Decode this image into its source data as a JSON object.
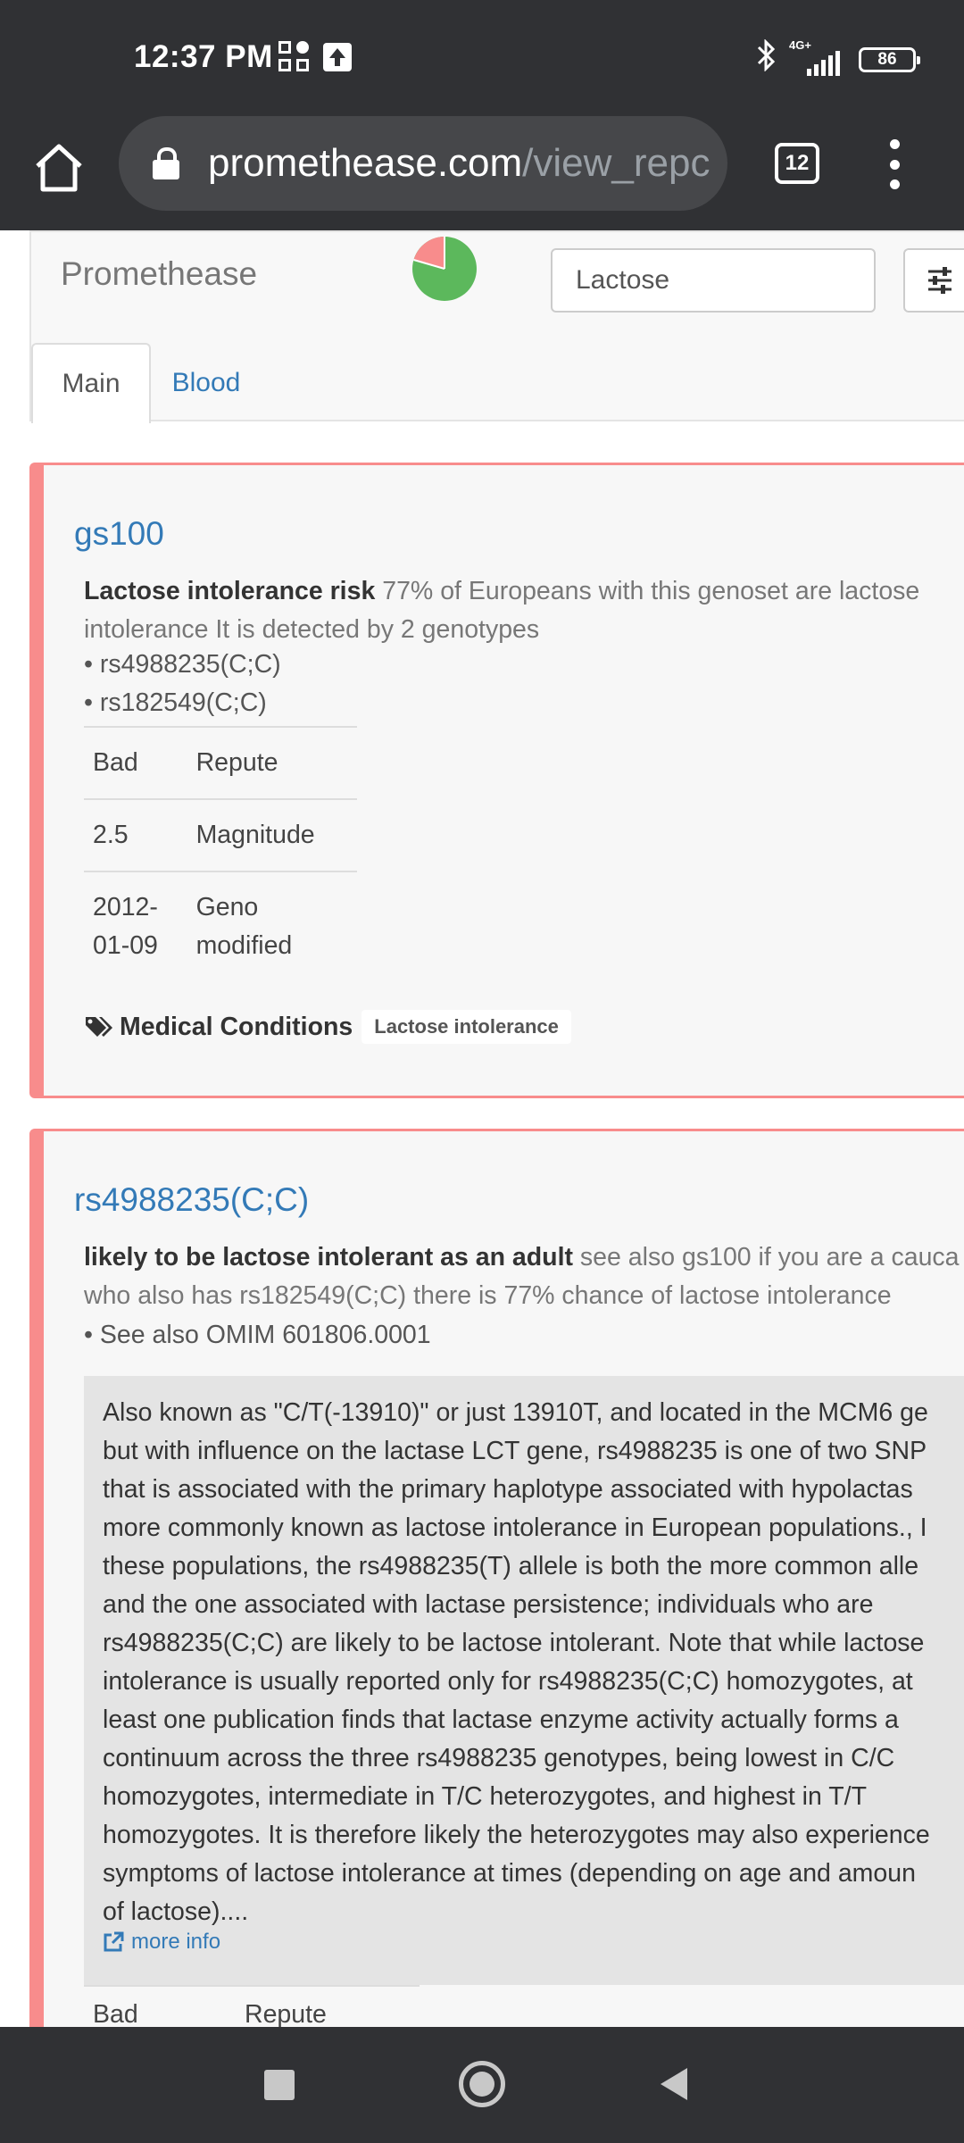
{
  "status_bar": {
    "time": "12:37 PM",
    "network_label": "4G+",
    "battery": "86",
    "icons": [
      "grid-app-icon",
      "upload-notification-icon",
      "bluetooth-icon",
      "signal-icon",
      "battery-icon"
    ]
  },
  "browser": {
    "url_host": "promethease.com",
    "url_path": "/view_repc",
    "tab_count": "12"
  },
  "header": {
    "brand": "Promethease",
    "pie_colors": {
      "good": "#5cb85c",
      "bad": "#f88c8c"
    },
    "search_value": "Lactose",
    "tabs": [
      {
        "label": "Main"
      },
      {
        "label": "Blood"
      }
    ]
  },
  "cards": [
    {
      "title": "gs100",
      "summary_bold": "Lactose intolerance risk",
      "summary_rest": " 77% of Europeans with this genoset are lactose intolerance It is detected by 2 genotypes",
      "bullets": [
        "• rs4988235(C;C)",
        "• rs182549(C;C)"
      ],
      "rows": [
        {
          "value": "Bad",
          "label": "Repute"
        },
        {
          "value": "2.5",
          "label": "Magnitude"
        },
        {
          "value": "2012-\n01-09",
          "label": "Geno\nmodified"
        }
      ],
      "tags_label": "Medical Conditions",
      "tag": "Lactose intolerance"
    },
    {
      "title": "rs4988235(C;C)",
      "summary_bold": "likely to be lactose intolerant as an adult",
      "summary_line1_rest": " see also gs100 if you are a cauca",
      "summary_line2": "who also has rs182549(C;C) there is 77% chance of lactose intolerance",
      "bullets": [
        "• See also OMIM 601806.0001"
      ],
      "quote": "Also known as \"C/T(-13910)\" or just 13910T, and located in the MCM6 ge\nbut with influence on the lactase LCT gene, rs4988235 is one of two SNP\nthat is associated with the primary haplotype associated with hypolactas\nmore commonly known as lactose intolerance in European populations., I\nthese populations, the rs4988235(T) allele is both the more common alle\nand the one associated with lactase persistence; individuals who are\nrs4988235(C;C) are likely to be lactose intolerant. Note that while lactose\nintolerance is usually reported only for rs4988235(C;C) homozygotes, at\nleast one publication finds that lactase enzyme activity actually forms a\ncontinuum across the three rs4988235 genotypes, being lowest in C/C\nhomozygotes, intermediate in T/C heterozygotes, and highest in T/T\nhomozygotes. It is therefore likely the heterozygotes may also experience\nsymptoms of lactose intolerance at times (depending on age and amoun\nof lactose)....",
      "more_info": "more info",
      "rows": [
        {
          "value": "Bad",
          "label": "Repute"
        }
      ]
    }
  ],
  "colors": {
    "card_border": "#f88c8c",
    "link": "#337ab7",
    "chrome": "#303134"
  }
}
